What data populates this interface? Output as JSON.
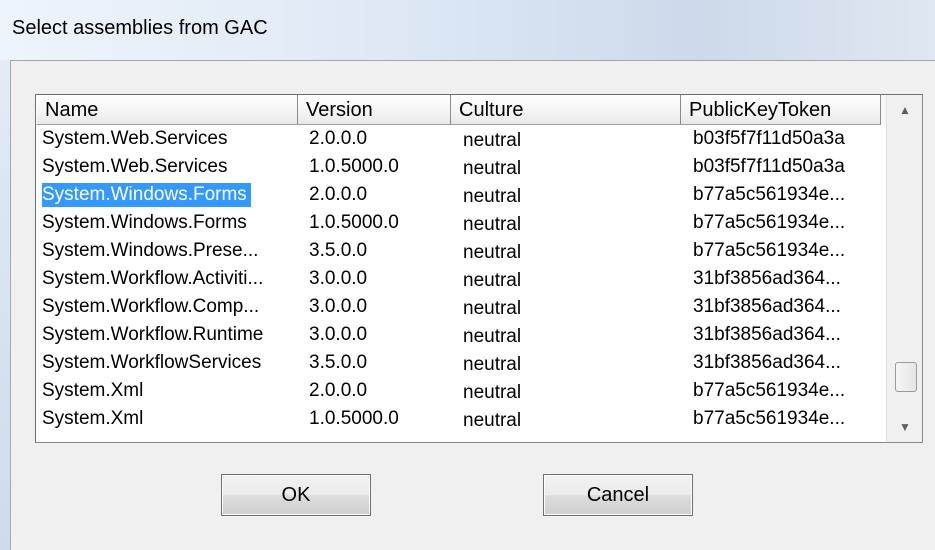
{
  "window": {
    "title": "Select assemblies from GAC"
  },
  "list": {
    "columns": [
      "Name",
      "Version",
      "Culture",
      "PublicKeyToken"
    ],
    "rows": [
      [
        "System.Web.Services",
        "2.0.0.0",
        "neutral",
        "b03f5f7f11d50a3a"
      ],
      [
        "System.Web.Services",
        "1.0.5000.0",
        "neutral",
        "b03f5f7f11d50a3a"
      ],
      [
        "System.Windows.Forms",
        "2.0.0.0",
        "neutral",
        "b77a5c561934e..."
      ],
      [
        "System.Windows.Forms",
        "1.0.5000.0",
        "neutral",
        "b77a5c561934e..."
      ],
      [
        "System.Windows.Prese...",
        "3.5.0.0",
        "neutral",
        "b77a5c561934e..."
      ],
      [
        "System.Workflow.Activiti...",
        "3.0.0.0",
        "neutral",
        "31bf3856ad364..."
      ],
      [
        "System.Workflow.Comp...",
        "3.0.0.0",
        "neutral",
        "31bf3856ad364..."
      ],
      [
        "System.Workflow.Runtime",
        "3.0.0.0",
        "neutral",
        "31bf3856ad364..."
      ],
      [
        "System.WorkflowServices",
        "3.5.0.0",
        "neutral",
        "31bf3856ad364..."
      ],
      [
        "System.Xml",
        "2.0.0.0",
        "neutral",
        "b77a5c561934e..."
      ],
      [
        "System.Xml",
        "1.0.5000.0",
        "neutral",
        "b77a5c561934e..."
      ]
    ],
    "selected_row": 2
  },
  "buttons": {
    "ok": "OK",
    "cancel": "Cancel"
  },
  "icons": {
    "scroll_up": "scroll-up-arrow-icon",
    "scroll_down": "scroll-down-arrow-icon"
  },
  "colors": {
    "selection": "#3399ff"
  }
}
